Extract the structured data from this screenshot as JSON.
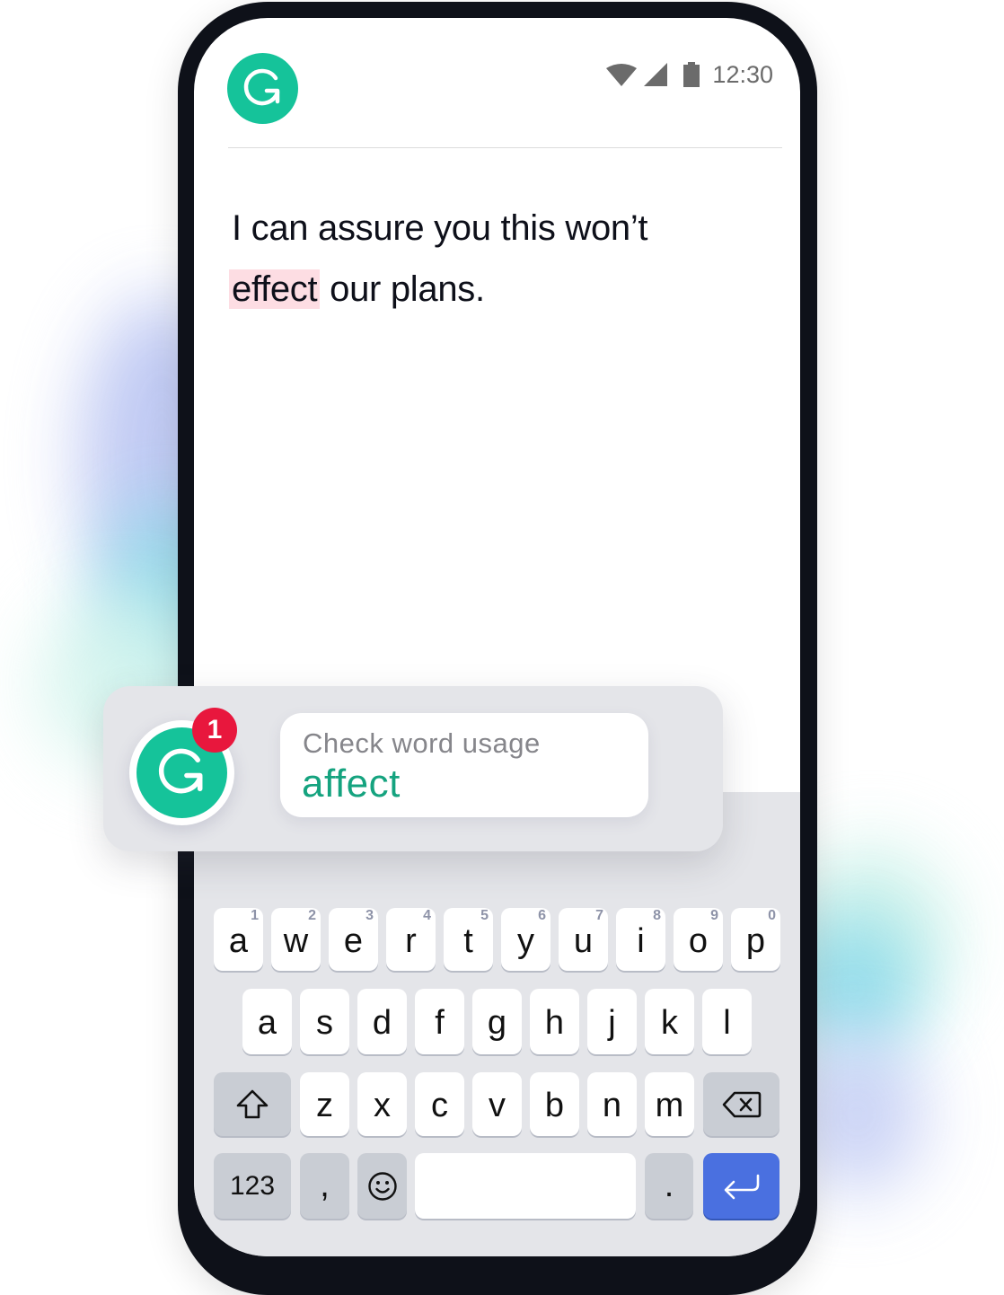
{
  "status_bar": {
    "icons": [
      "wifi-icon",
      "cell-signal-icon",
      "battery-icon"
    ],
    "time": "12:30"
  },
  "app": {
    "logo_icon": "grammarly-g-logo",
    "brand_color": "#15c39a"
  },
  "editor": {
    "text_before": "I can assure you this won’t",
    "flagged_word": "effect",
    "text_after": " our plans.",
    "highlight_color": "#fddde3"
  },
  "suggestion_popup": {
    "badge_count": "1",
    "badge_color": "#e8173d",
    "title": "Check word usage",
    "replacement": "affect",
    "replacement_color": "#15a37f"
  },
  "keyboard": {
    "row1": [
      {
        "key": "a",
        "hint": "1"
      },
      {
        "key": "w",
        "hint": "2"
      },
      {
        "key": "e",
        "hint": "3"
      },
      {
        "key": "r",
        "hint": "4"
      },
      {
        "key": "t",
        "hint": "5"
      },
      {
        "key": "y",
        "hint": "6"
      },
      {
        "key": "u",
        "hint": "7"
      },
      {
        "key": "i",
        "hint": "8"
      },
      {
        "key": "o",
        "hint": "9"
      },
      {
        "key": "p",
        "hint": "0"
      }
    ],
    "row2": [
      "a",
      "s",
      "d",
      "f",
      "g",
      "h",
      "j",
      "k",
      "l"
    ],
    "row3": [
      "z",
      "x",
      "c",
      "v",
      "b",
      "n",
      "m"
    ],
    "shift_icon": "shift-arrow-icon",
    "backspace_icon": "backspace-icon",
    "numbers_label": "123",
    "comma_label": ",",
    "emoji_icon": "smiley-icon",
    "space_label": "",
    "period_label": ".",
    "enter_icon": "return-arrow-icon",
    "enter_color": "#4a70e0"
  }
}
